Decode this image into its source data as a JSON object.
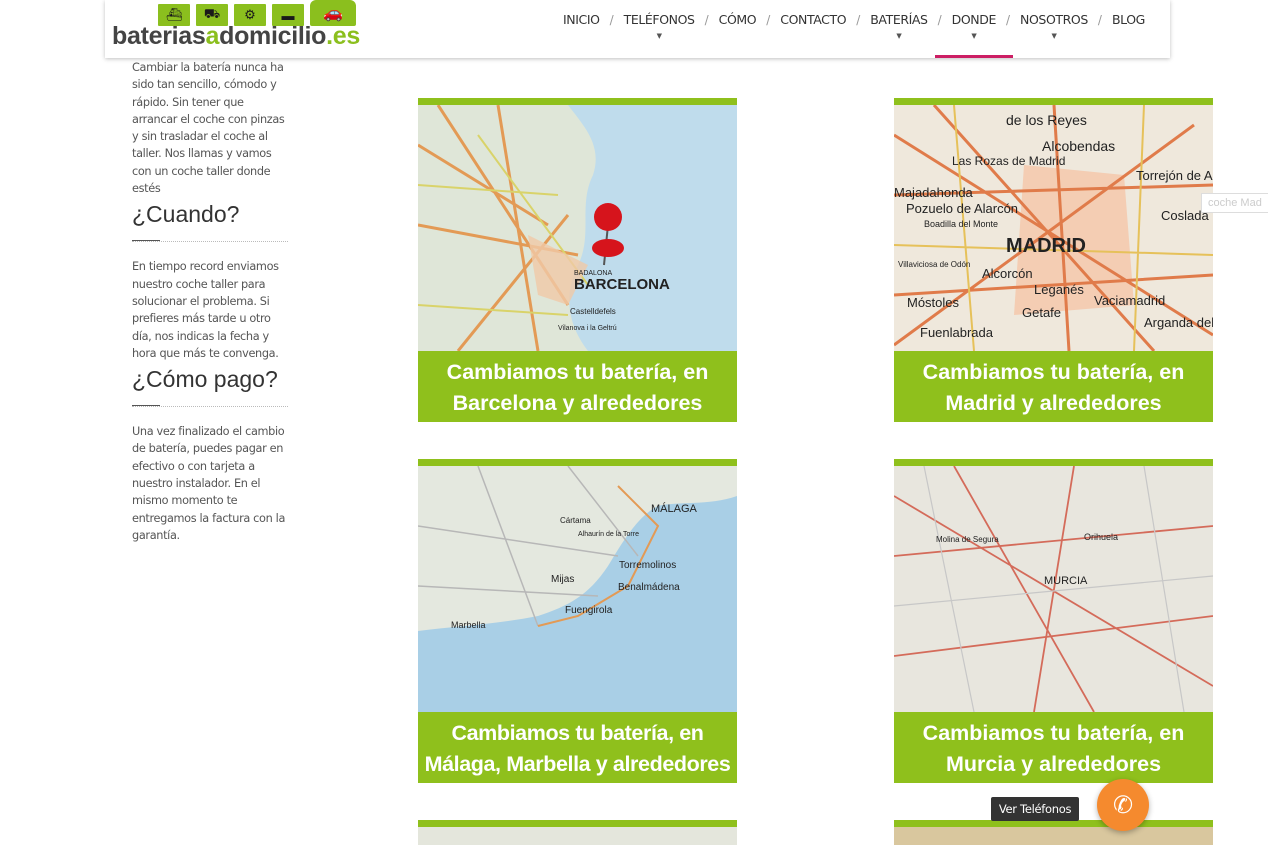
{
  "header": {
    "logo": {
      "text_main": "baterias",
      "text_a": "a",
      "text_rest": "domicilio",
      "text_es": ".es"
    },
    "nav": [
      {
        "label": "INICIO",
        "has_submenu": false,
        "active": false
      },
      {
        "label": "TELÉFONOS",
        "has_submenu": true,
        "active": false
      },
      {
        "label": "CÓMO",
        "has_submenu": false,
        "active": false
      },
      {
        "label": "CONTACTO",
        "has_submenu": false,
        "active": false
      },
      {
        "label": "BATERÍAS",
        "has_submenu": true,
        "active": false
      },
      {
        "label": "DONDE",
        "has_submenu": true,
        "active": true
      },
      {
        "label": "NOSOTROS",
        "has_submenu": true,
        "active": false
      },
      {
        "label": "BLOG",
        "has_submenu": false,
        "active": false
      }
    ],
    "separator": "/"
  },
  "sidebar": {
    "intro": "Cambiar la batería nunca ha sido tan sencillo, cómodo y rápido. Sin tener que arrancar el coche con pinzas y sin trasladar el coche al taller. Nos llamas y vamos con un coche taller donde estés",
    "cuando_title": "¿Cuando?",
    "cuando_text": "En tiempo record enviamos nuestro coche taller para solucionar el problema. Si prefieres más tarde u otro día, nos indicas la fecha y hora que más te convenga.",
    "pago_title": "¿Cómo pago?",
    "pago_text": "Una vez finalizado el cambio de batería, puedes pagar en efectivo o con tarjeta a nuestro instalador. En el mismo momento te entregamos la factura con la garantía."
  },
  "cards": [
    {
      "line1": "Cambiamos tu batería, en",
      "line2": "Barcelona y alrededores",
      "map_label": "BARCELONA"
    },
    {
      "line1": "Cambiamos tu batería, en",
      "line2": "Madrid y alrededores",
      "map_label": "MADRID"
    },
    {
      "line1": "Cambiamos tu batería, en",
      "line2": "Málaga, Marbella y alrededores",
      "map_label": "MÁLAGA"
    },
    {
      "line1": "Cambiamos tu batería, en",
      "line2": "Murcia y alrededores",
      "map_label": "MURCIA"
    }
  ],
  "map_labels": {
    "barcelona": [
      "BARCELONA",
      "BADALONA",
      "Castelldefels",
      "Vilanova i la Geltrú"
    ],
    "madrid": [
      "MADRID",
      "Alcobendas",
      "Las Rozas de Madrid",
      "Torrejón de Ardoz",
      "Pozuelo de Alarcón",
      "Coslada",
      "Alcorcón",
      "Leganés",
      "Móstoles",
      "Getafe",
      "Fuenlabrada",
      "Vaciamadrid",
      "Arganda del Rey",
      "Majadahonda",
      "Boadilla del Monte",
      "de los Reyes",
      "Villaviciosa de Odón"
    ],
    "malaga": [
      "MÁLAGA",
      "Torremolinos",
      "Benalmádena",
      "Fuengirola",
      "Mijas",
      "Marbella",
      "Cártama",
      "Alhaurín de la Torre"
    ],
    "murcia": [
      "MURCIA",
      "Orihuela",
      "Molina de Segura"
    ]
  },
  "side_tag": "coche Mad",
  "floating": {
    "tooltip": "Ver Teléfonos",
    "phone_icon": "phone-icon"
  },
  "colors": {
    "green": "#8fc01c",
    "accent": "#cc1e64",
    "orange": "#f58a2e",
    "sea": "#a9cfe6"
  }
}
